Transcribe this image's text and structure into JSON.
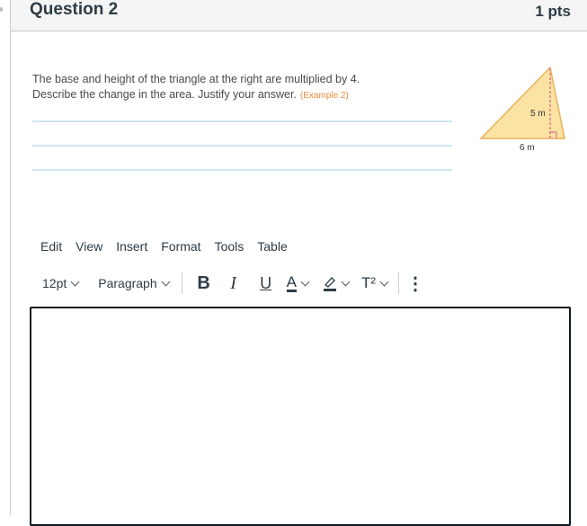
{
  "question": {
    "title": "Question 2",
    "points": "1 pts",
    "prompt_line1": "The base and height of the triangle at the right are multiplied by 4.",
    "prompt_line2": "Describe the change in the area. Justify your answer.",
    "reference": "(Example 2)",
    "figure": {
      "height_label": "5 m",
      "base_label": "6 m",
      "fill_color": "#fbe3a4",
      "dash_color": "#e07a8a"
    }
  },
  "editor": {
    "menu": [
      "Edit",
      "View",
      "Insert",
      "Format",
      "Tools",
      "Table"
    ],
    "font_size": "12pt",
    "block_format": "Paragraph",
    "buttons": {
      "bold": "B",
      "italic": "I",
      "underline": "U",
      "text_color": "A",
      "superscript": "T²",
      "more": "⋮"
    },
    "content": ""
  }
}
